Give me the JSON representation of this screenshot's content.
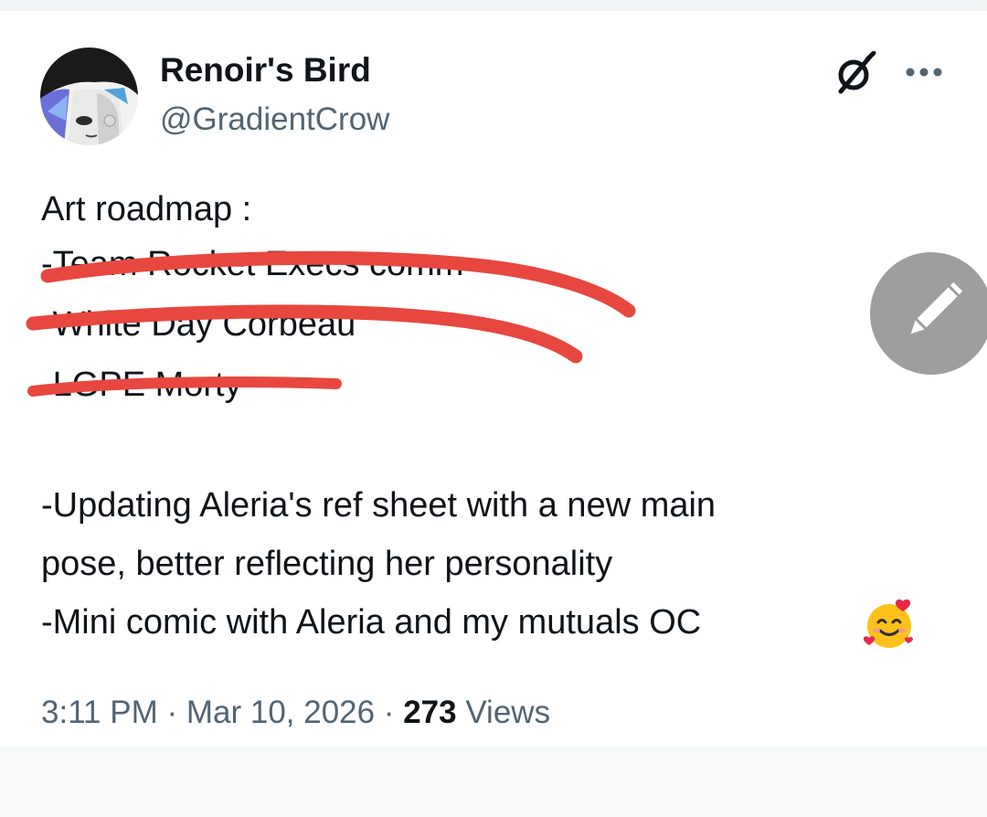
{
  "tweet": {
    "author": {
      "display_name": "Renoir's Bird",
      "handle": "@GradientCrow"
    },
    "header_icons": [
      "grok-icon",
      "more-options-icon"
    ],
    "lines": {
      "heading": "Art roadmap :",
      "struck_1": "-Team Rocket Execs comm",
      "struck_2": "-White Day Corbeau",
      "struck_3": "-LGPE Morty",
      "item_1a": "-Updating Aleria's ref sheet with a new main",
      "item_1b": "pose, better reflecting her personality",
      "item_2": "-Mini comic with Aleria and my mutuals OC"
    },
    "emoji": "smiling-face-with-hearts",
    "meta": {
      "time": "3:11 PM",
      "separator": " · ",
      "date": "Mar 10, 2026",
      "views_count": "273",
      "views_label": " Views"
    }
  },
  "fab": {
    "icon": "pencil-icon"
  },
  "colors": {
    "strike_red": "#e8473f",
    "secondary_text": "#536471",
    "fab_gray": "#9e9e9e"
  }
}
